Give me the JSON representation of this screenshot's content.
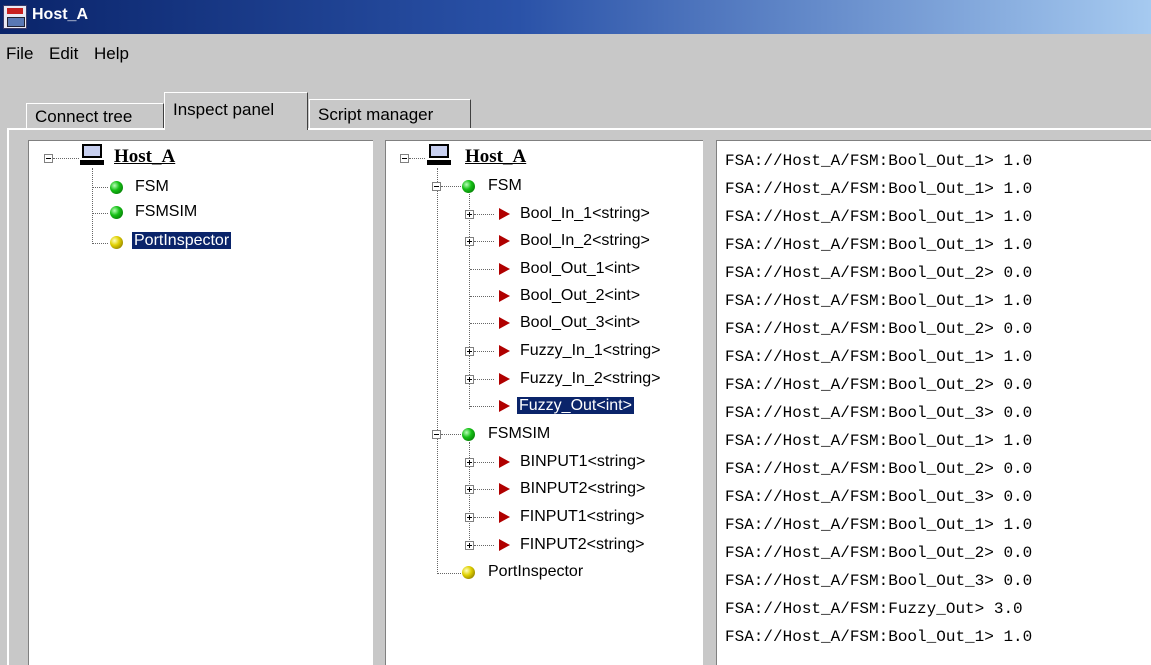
{
  "window": {
    "title": "Host_A"
  },
  "menu": {
    "file": "File",
    "edit": "Edit",
    "help": "Help"
  },
  "tabs": {
    "connect_tree": "Connect tree",
    "inspect_panel": "Inspect panel",
    "script_manager": "Script manager"
  },
  "left_tree": {
    "root": "Host_A",
    "items": [
      "FSM",
      "FSMSIM",
      "PortInspector"
    ]
  },
  "mid_tree": {
    "root": "Host_A",
    "fsm": "FSM",
    "fsm_ports": [
      "Bool_In_1<string>",
      "Bool_In_2<string>",
      "Bool_Out_1<int>",
      "Bool_Out_2<int>",
      "Bool_Out_3<int>",
      "Fuzzy_In_1<string>",
      "Fuzzy_In_2<string>",
      "Fuzzy_Out<int>"
    ],
    "fsmsim": "FSMSIM",
    "fsmsim_ports": [
      "BINPUT1<string>",
      "BINPUT2<string>",
      "FINPUT1<string>",
      "FINPUT2<string>"
    ],
    "portinspector": "PortInspector"
  },
  "log": [
    "FSA://Host_A/FSM:Bool_Out_1> 1.0",
    "FSA://Host_A/FSM:Bool_Out_1> 1.0",
    "FSA://Host_A/FSM:Bool_Out_1> 1.0",
    "FSA://Host_A/FSM:Bool_Out_1> 1.0",
    "FSA://Host_A/FSM:Bool_Out_2> 0.0",
    "FSA://Host_A/FSM:Bool_Out_1> 1.0",
    "FSA://Host_A/FSM:Bool_Out_2> 0.0",
    "FSA://Host_A/FSM:Bool_Out_1> 1.0",
    "FSA://Host_A/FSM:Bool_Out_2> 0.0",
    "FSA://Host_A/FSM:Bool_Out_3> 0.0",
    "FSA://Host_A/FSM:Bool_Out_1> 1.0",
    "FSA://Host_A/FSM:Bool_Out_2> 0.0",
    "FSA://Host_A/FSM:Bool_Out_3> 0.0",
    "FSA://Host_A/FSM:Bool_Out_1> 1.0",
    "FSA://Host_A/FSM:Bool_Out_2> 0.0",
    "FSA://Host_A/FSM:Bool_Out_3> 0.0",
    "FSA://Host_A/FSM:Fuzzy_Out> 3.0",
    "FSA://Host_A/FSM:Bool_Out_1> 1.0"
  ],
  "icons": {
    "host": "computer-icon",
    "component": "green-ball-icon",
    "inspector": "yellow-ball-icon",
    "port": "red-triangle-icon"
  }
}
